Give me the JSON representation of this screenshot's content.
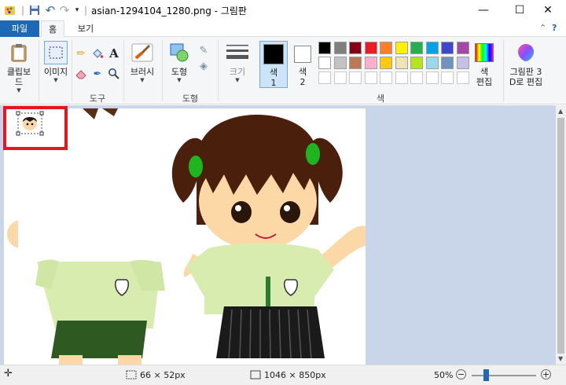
{
  "window": {
    "title": "asian-1294104_1280.png - 그림판",
    "minimize": "—",
    "maximize": "☐",
    "close": "✕"
  },
  "quick_access": {
    "customize": "▾"
  },
  "tabs": {
    "file": "파일",
    "home": "홈",
    "view": "보기"
  },
  "ribbon": {
    "clipboard": {
      "label": "클립보드"
    },
    "image": {
      "label": "이미지"
    },
    "tools": {
      "group_label": "도구"
    },
    "brushes": {
      "label": "브러시"
    },
    "shapes": {
      "label": "도형",
      "group_label": "도형"
    },
    "size": {
      "label": "크기"
    },
    "color1": {
      "label": "색",
      "number": "1"
    },
    "color2": {
      "label": "색",
      "number": "2"
    },
    "colors_group_label": "색",
    "edit_colors": {
      "line1": "색",
      "line2": "편집"
    },
    "paint3d": {
      "line1": "그림판 3",
      "line2": "D로 편집"
    }
  },
  "palette": {
    "row1": [
      "#000000",
      "#7f7f7f",
      "#880015",
      "#ed1c24",
      "#ff7f27",
      "#fff200",
      "#22b14c",
      "#00a2e8",
      "#3f48cc",
      "#a349a4"
    ],
    "row2": [
      "#ffffff",
      "#c3c3c3",
      "#b97a57",
      "#ffaec9",
      "#ffc90e",
      "#efe4b0",
      "#b5e61d",
      "#99d9ea",
      "#7092be",
      "#c8bfe7"
    ]
  },
  "status": {
    "selection_size": "66 × 52px",
    "image_size": "1046 × 850px",
    "zoom": "50%",
    "zoom_out": "−",
    "zoom_in": "+",
    "zoom_fraction": 0.5
  }
}
